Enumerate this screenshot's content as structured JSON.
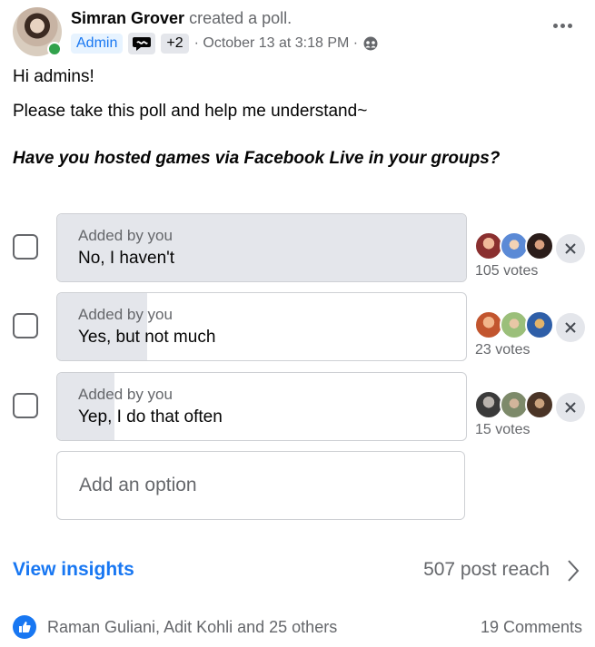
{
  "post": {
    "author_name": "Simran Grover",
    "action": "created a poll.",
    "badges": {
      "admin": "Admin",
      "extra": "+2"
    },
    "timestamp": "· October 13 at 3:18 PM ·",
    "privacy_icon": "group-icon"
  },
  "body": {
    "line1": "Hi admins!",
    "line2": "Please take this poll and help me understand~",
    "question": "Have you hosted games via Facebook Live in your groups?"
  },
  "poll": {
    "options": [
      {
        "added_by": "Added by you",
        "label": "No, I haven't",
        "votes": "105 votes",
        "fill_fraction": 1.0
      },
      {
        "added_by": "Added by you",
        "label": "Yes, but not much",
        "votes": "23 votes",
        "fill_fraction": 0.22
      },
      {
        "added_by": "Added by you",
        "label": "Yep, I do that often",
        "votes": "15 votes",
        "fill_fraction": 0.14
      }
    ],
    "add_option_placeholder": "Add an option"
  },
  "insights": {
    "view_label": "View insights",
    "reach": "507 post reach"
  },
  "footer": {
    "reactors": "Raman Guliani, Adit Kohli and 25 others",
    "comments": "19 Comments"
  },
  "colors": {
    "accent": "#1877f2",
    "online": "#31a24c",
    "secondary_text": "#65676b",
    "fill": "#e4e6eb"
  }
}
